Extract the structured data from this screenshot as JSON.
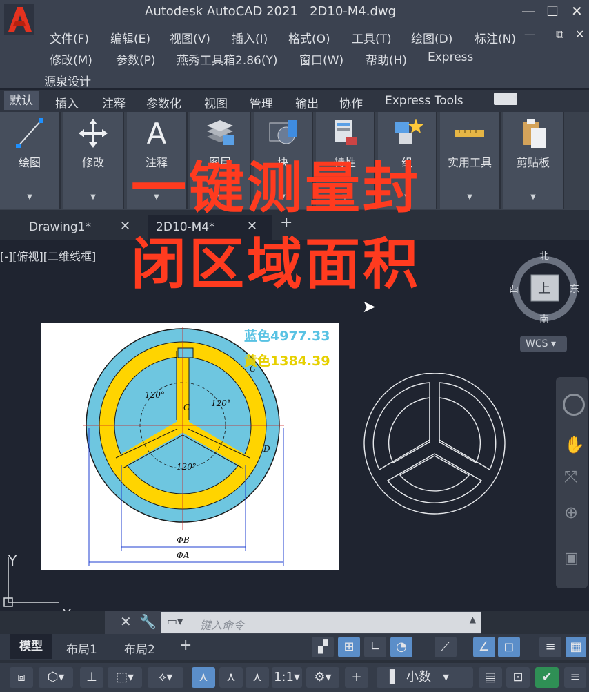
{
  "window": {
    "app_title": "Autodesk AutoCAD 2021",
    "file_name": "2D10-M4.dwg"
  },
  "menu": {
    "row1": [
      "文件(F)",
      "编辑(E)",
      "视图(V)",
      "插入(I)",
      "格式(O)",
      "工具(T)",
      "绘图(D)",
      "标注(N)"
    ],
    "row2": [
      "修改(M)",
      "参数(P)",
      "燕秀工具箱2.86(Y)",
      "窗口(W)",
      "帮助(H)",
      "Express"
    ],
    "row3": [
      "源泉设计"
    ]
  },
  "ribbon_tabs": [
    "默认",
    "插入",
    "注释",
    "参数化",
    "视图",
    "管理",
    "输出",
    "协作",
    "Express Tools"
  ],
  "ribbon_panels": [
    "绘图",
    "修改",
    "注释",
    "图层",
    "块",
    "特性",
    "组",
    "实用工具",
    "剪贴板"
  ],
  "doc_tabs": [
    "Drawing1*",
    "2D10-M4*"
  ],
  "viewport_label": "[-][俯视][二维线框]",
  "overlay": {
    "line1": "一键测量封",
    "line2": "闭区域面积"
  },
  "viewcube": {
    "north": "北",
    "south": "南",
    "east": "东",
    "west": "西",
    "face": "上",
    "wcs": "WCS"
  },
  "image": {
    "blue_label": "蓝色4977.33",
    "yellow_label": "黄色1384.39",
    "angles": [
      "120°",
      "120°",
      "120°"
    ],
    "dims": [
      "C",
      "C",
      "D",
      "ΦB",
      "ΦA"
    ]
  },
  "ucs": {
    "x": "X",
    "y": "Y"
  },
  "command": {
    "placeholder": "键入命令"
  },
  "layout_tabs": [
    "模型",
    "布局1",
    "布局2"
  ],
  "status": {
    "scale": "1:1",
    "units": "小数"
  },
  "colors": {
    "accent_red": "#ff3b1f",
    "blue_fill": "#6ec6e0",
    "yellow_fill": "#ffd400"
  }
}
